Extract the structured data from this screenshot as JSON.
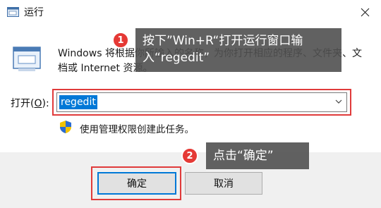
{
  "window": {
    "title": "运行",
    "description": "Windows 将根据你所输入的名称，为你打开相应的程序、文件夹、文档或 Internet 资源。",
    "open_label": "打开(",
    "open_label_key": "O",
    "open_label_suffix": "):",
    "input_value": "regedit",
    "admin_note": "使用管理权限创建此任务。",
    "ok_label": "确定",
    "cancel_label": "取消"
  },
  "callouts": [
    {
      "number": "1",
      "text": "按下”Win+R“打开运行窗口输入“regedit”"
    },
    {
      "number": "2",
      "text": "点击“确定”"
    }
  ],
  "colors": {
    "accent": "#0078d7",
    "highlight": "#e03b3b",
    "badge": "#e53935",
    "callout_bg": "#505050"
  }
}
